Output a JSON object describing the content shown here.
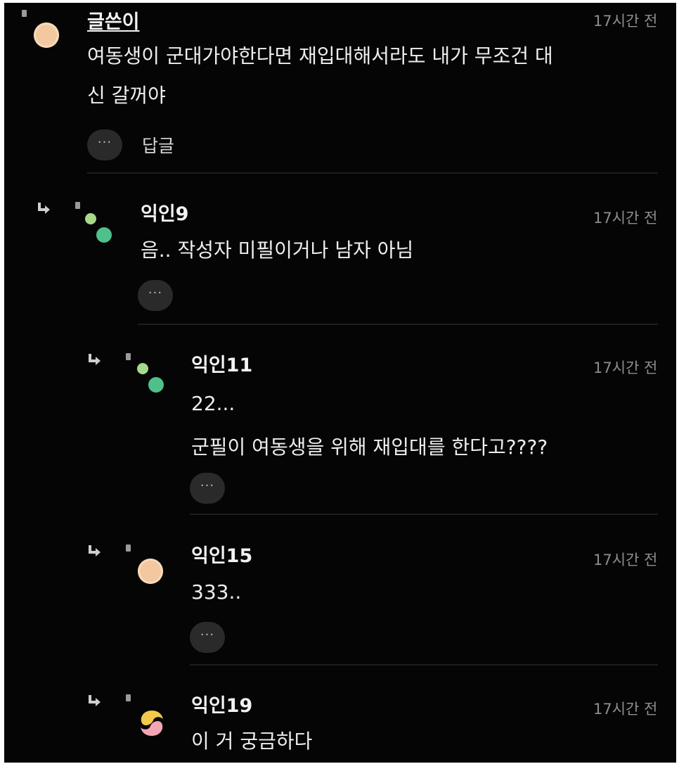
{
  "comments": [
    {
      "author": "글쓴이",
      "time": "17시간 전",
      "lines": [
        "여동생이 군대가야한다면 재입대해서라도 내가 무조건 대",
        "신 갈꺼야"
      ],
      "reply_label": "답글",
      "more_label": "···",
      "avatar": "peach-circle-avatar"
    },
    {
      "author": "익인9",
      "time": "17시간 전",
      "lines": [
        "음.. 작성자 미필이거나 남자 아님"
      ],
      "more_label": "···",
      "avatar": "green-dots-avatar"
    },
    {
      "author": "익인11",
      "time": "17시간 전",
      "lines": [
        "22...",
        "군필이 여동생을 위해 재입대를 한다고????"
      ],
      "more_label": "···",
      "avatar": "green-dots-avatar"
    },
    {
      "author": "익인15",
      "time": "17시간 전",
      "lines": [
        "333.."
      ],
      "more_label": "···",
      "avatar": "peach-circle-avatar"
    },
    {
      "author": "익인19",
      "time": "17시간 전",
      "lines": [
        "이 거 궁금하다"
      ],
      "avatar": "yellow-pink-swirl-avatar"
    }
  ],
  "colors": {
    "background": "#050505",
    "text": "#eeeeee",
    "muted": "#8e8e8e",
    "peach": "#f3c8a0",
    "green_light": "#a7d98a",
    "green": "#4fc08a"
  }
}
